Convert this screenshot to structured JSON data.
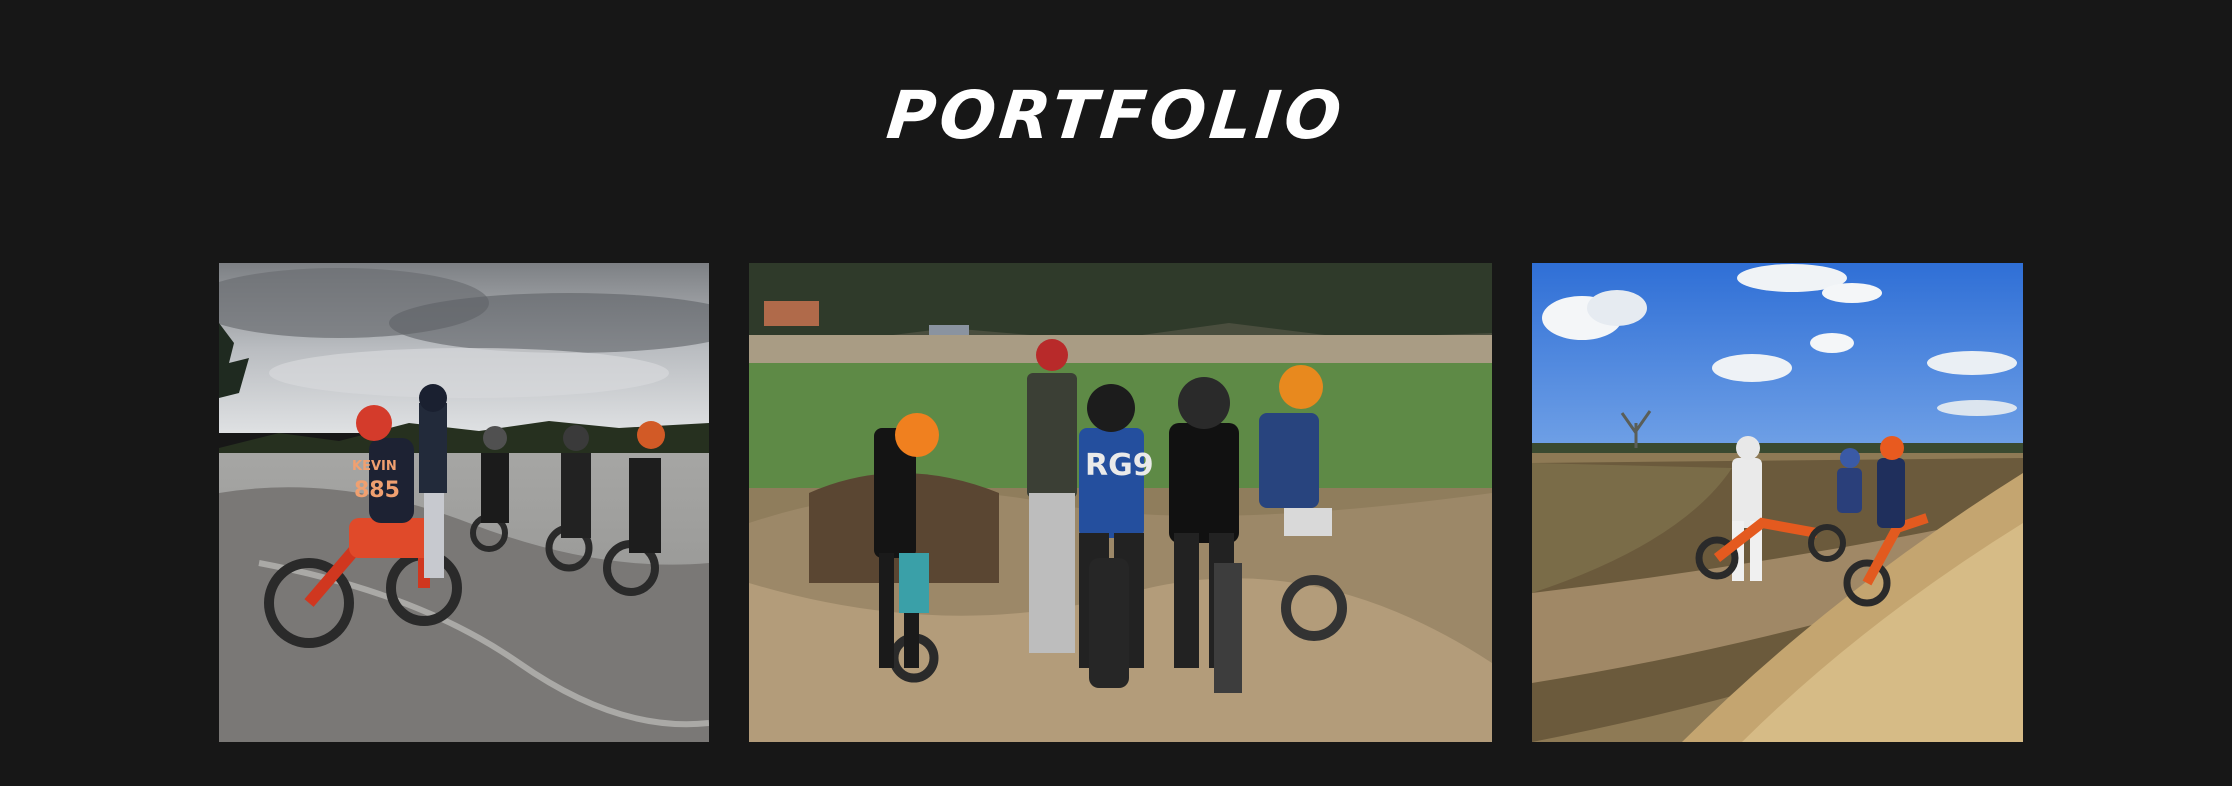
{
  "page": {
    "title": "PORTFOLIO",
    "background": "#171717",
    "text_color": "#ffffff"
  },
  "gallery": {
    "photos": [
      {
        "subject": "motocross-riders-snowy-muddy-track",
        "rider_jersey_text": "KEVIN",
        "rider_number": "885"
      },
      {
        "subject": "young-riders-gathered-around-coach-field",
        "rider_jersey_text": "RG9"
      },
      {
        "subject": "riders-on-dirt-track-blue-sky"
      }
    ]
  }
}
